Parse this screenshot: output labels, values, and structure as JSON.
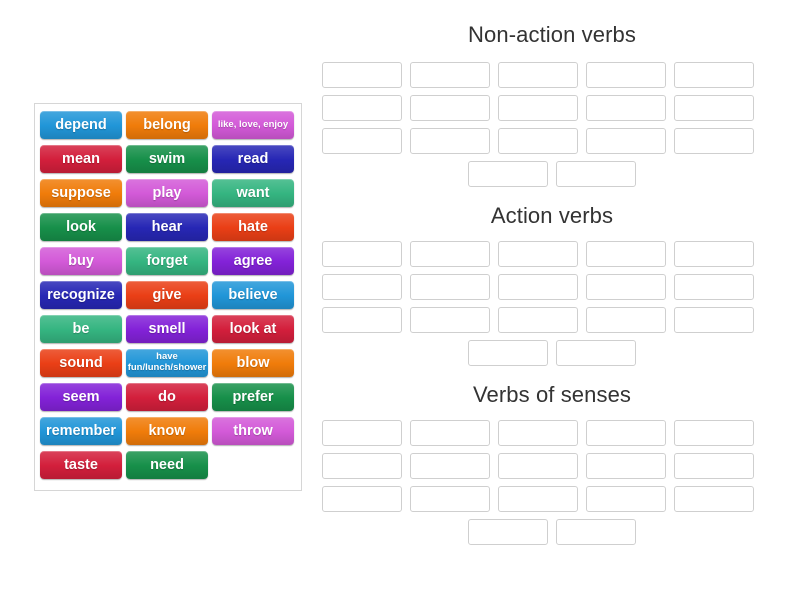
{
  "word_bank": {
    "name": "word-bank",
    "tiles": [
      {
        "label": "depend",
        "color": "#2196d8",
        "multiline": false
      },
      {
        "label": "belong",
        "color": "#f07c0a",
        "multiline": false
      },
      {
        "label": "like, love, enjoy",
        "color": "#d35ad8",
        "multiline": true
      },
      {
        "label": "mean",
        "color": "#d31f3c",
        "multiline": false
      },
      {
        "label": "swim",
        "color": "#17904a",
        "multiline": false
      },
      {
        "label": "read",
        "color": "#2727b5",
        "multiline": false
      },
      {
        "label": "suppose",
        "color": "#f07c0a",
        "multiline": false
      },
      {
        "label": "play",
        "color": "#d35ad8",
        "multiline": false
      },
      {
        "label": "want",
        "color": "#35b581",
        "multiline": false
      },
      {
        "label": "look",
        "color": "#17904a",
        "multiline": false
      },
      {
        "label": "hear",
        "color": "#2727b5",
        "multiline": false
      },
      {
        "label": "hate",
        "color": "#ea3f16",
        "multiline": false
      },
      {
        "label": "buy",
        "color": "#d35ad8",
        "multiline": false
      },
      {
        "label": "forget",
        "color": "#35b581",
        "multiline": false
      },
      {
        "label": "agree",
        "color": "#8322d8",
        "multiline": false
      },
      {
        "label": "recognize",
        "color": "#2727b5",
        "multiline": false
      },
      {
        "label": "give",
        "color": "#ea3f16",
        "multiline": false
      },
      {
        "label": "believe",
        "color": "#2196d8",
        "multiline": false
      },
      {
        "label": "be",
        "color": "#35b581",
        "multiline": false
      },
      {
        "label": "smell",
        "color": "#8322d8",
        "multiline": false
      },
      {
        "label": "look at",
        "color": "#d31f3c",
        "multiline": false
      },
      {
        "label": "sound",
        "color": "#ea3f16",
        "multiline": false
      },
      {
        "label": "have fun/lunch/shower",
        "color": "#2196d8",
        "multiline": true
      },
      {
        "label": "blow",
        "color": "#f07c0a",
        "multiline": false
      },
      {
        "label": "seem",
        "color": "#8322d8",
        "multiline": false
      },
      {
        "label": "do",
        "color": "#d31f3c",
        "multiline": false
      },
      {
        "label": "prefer",
        "color": "#17904a",
        "multiline": false
      },
      {
        "label": "remember",
        "color": "#2196d8",
        "multiline": false
      },
      {
        "label": "know",
        "color": "#f07c0a",
        "multiline": false
      },
      {
        "label": "throw",
        "color": "#d35ad8",
        "multiline": false
      },
      {
        "label": "taste",
        "color": "#d31f3c",
        "multiline": false
      },
      {
        "label": "need",
        "color": "#17904a",
        "multiline": false
      },
      {
        "label": "",
        "color": "",
        "multiline": false
      }
    ]
  },
  "groups": [
    {
      "title": "Non-action verbs",
      "rows": [
        {
          "slots": [
            "",
            "",
            "",
            "",
            ""
          ],
          "centered": false
        },
        {
          "slots": [
            "",
            "",
            "",
            "",
            ""
          ],
          "centered": false
        },
        {
          "slots": [
            "",
            "",
            "",
            "",
            ""
          ],
          "centered": false
        },
        {
          "slots": [
            "",
            ""
          ],
          "centered": true
        }
      ]
    },
    {
      "title": "Action verbs",
      "rows": [
        {
          "slots": [
            "",
            "",
            "",
            "",
            ""
          ],
          "centered": false
        },
        {
          "slots": [
            "",
            "",
            "",
            "",
            ""
          ],
          "centered": false
        },
        {
          "slots": [
            "",
            "",
            "",
            "",
            ""
          ],
          "centered": false
        },
        {
          "slots": [
            "",
            ""
          ],
          "centered": true
        }
      ]
    },
    {
      "title": "Verbs of senses",
      "rows": [
        {
          "slots": [
            "",
            "",
            "",
            "",
            ""
          ],
          "centered": false
        },
        {
          "slots": [
            "",
            "",
            "",
            "",
            ""
          ],
          "centered": false
        },
        {
          "slots": [
            "",
            "",
            "",
            "",
            ""
          ],
          "centered": false
        },
        {
          "slots": [
            "",
            ""
          ],
          "centered": true
        }
      ]
    }
  ],
  "colors": {
    "page_background": "#ffffff",
    "bank_border": "#d6d6d6",
    "slot_border": "#cfcfcf",
    "title_text": "#333333",
    "tile_text": "#ffffff"
  }
}
